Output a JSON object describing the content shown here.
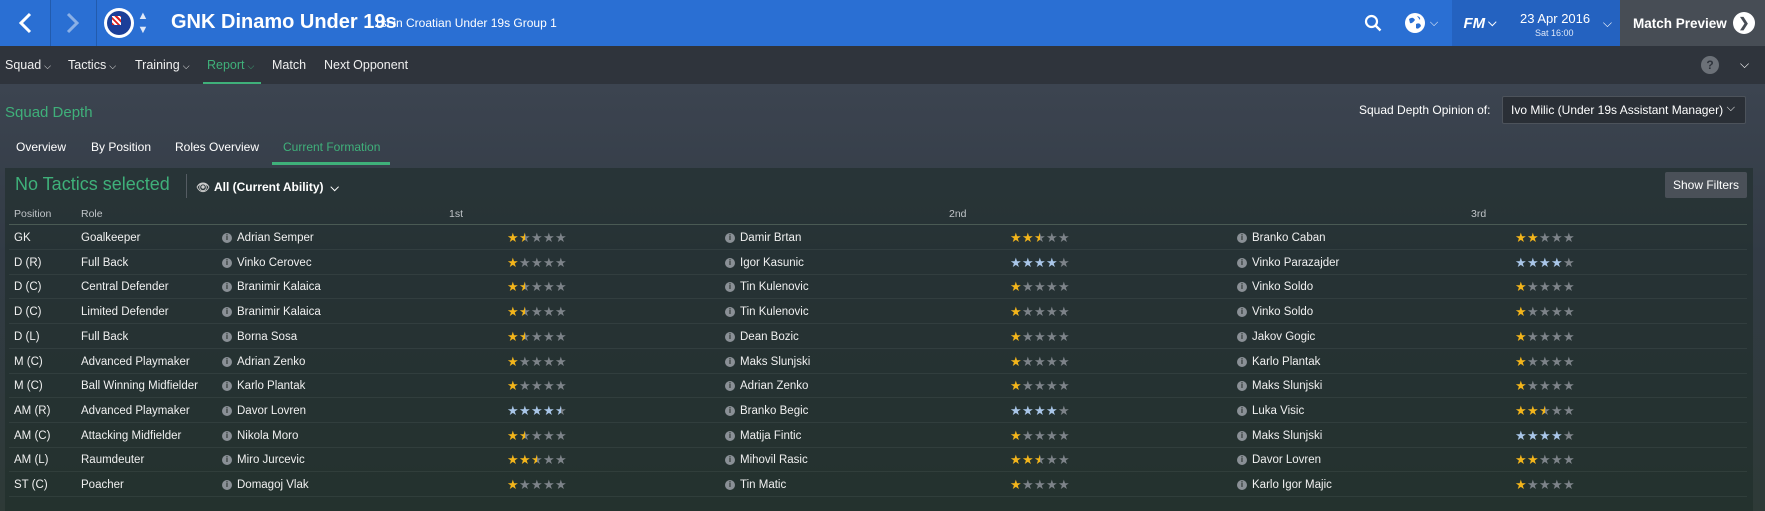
{
  "header": {
    "team_name": "GNK Dinamo Under 19s",
    "team_subtitle": "1st in Croatian Under 19s Group 1",
    "fm_label": "FM",
    "date": "23 Apr 2016",
    "time": "Sat 16:00",
    "continue_label": "Match Preview"
  },
  "menu": {
    "items": [
      {
        "label": "Squad"
      },
      {
        "label": "Tactics"
      },
      {
        "label": "Training"
      },
      {
        "label": "Report"
      },
      {
        "label": "Match"
      },
      {
        "label": "Next Opponent"
      }
    ],
    "help": "?"
  },
  "page": {
    "title": "Squad Depth",
    "opinion_label": "Squad Depth Opinion of:",
    "opinion_value": "Ivo Milic (Under 19s Assistant Manager)",
    "subtabs": [
      "Overview",
      "By Position",
      "Roles Overview",
      "Current Formation"
    ],
    "no_tactics": "No Tactics selected",
    "filter_label": "All (Current Ability)",
    "show_filters": "Show Filters"
  },
  "table": {
    "headers": {
      "position": "Position",
      "role": "Role",
      "first": "1st",
      "second": "2nd",
      "third": "3rd"
    },
    "rows": [
      {
        "pos": "GK",
        "role": "Goalkeeper",
        "p1": "Adrian Semper",
        "r1": 1.5,
        "p2": "Damir Brtan",
        "r2": 2.5,
        "p3": "Branko Caban",
        "r3": 2
      },
      {
        "pos": "D (R)",
        "role": "Full Back",
        "p1": "Vinko Cerovec",
        "r1": 1,
        "p2": "Igor Kasunic",
        "r2": 4,
        "p3": "Vinko Parazajder",
        "r3": 4
      },
      {
        "pos": "D (C)",
        "role": "Central Defender",
        "p1": "Branimir Kalaica",
        "r1": 1.5,
        "p2": "Tin Kulenovic",
        "r2": 1,
        "p3": "Vinko Soldo",
        "r3": 1
      },
      {
        "pos": "D (C)",
        "role": "Limited Defender",
        "p1": "Branimir Kalaica",
        "r1": 1.5,
        "p2": "Tin Kulenovic",
        "r2": 1,
        "p3": "Vinko Soldo",
        "r3": 1
      },
      {
        "pos": "D (L)",
        "role": "Full Back",
        "p1": "Borna Sosa",
        "r1": 1.5,
        "p2": "Dean Bozic",
        "r2": 1,
        "p3": "Jakov Gogic",
        "r3": 1
      },
      {
        "pos": "M (C)",
        "role": "Advanced Playmaker",
        "p1": "Adrian Zenko",
        "r1": 1,
        "p2": "Maks Slunjski",
        "r2": 1,
        "p3": "Karlo Plantak",
        "r3": 1
      },
      {
        "pos": "M (C)",
        "role": "Ball Winning Midfielder",
        "p1": "Karlo Plantak",
        "r1": 1,
        "p2": "Adrian Zenko",
        "r2": 1,
        "p3": "Maks Slunjski",
        "r3": 1
      },
      {
        "pos": "AM (R)",
        "role": "Advanced Playmaker",
        "p1": "Davor Lovren",
        "r1": 4.5,
        "p2": "Branko Begic",
        "r2": 4,
        "p3": "Luka Visic",
        "r3": 2.5
      },
      {
        "pos": "AM (C)",
        "role": "Attacking Midfielder",
        "p1": "Nikola Moro",
        "r1": 1.5,
        "p2": "Matija Fintic",
        "r2": 1,
        "p3": "Maks Slunjski",
        "r3": 4
      },
      {
        "pos": "AM (L)",
        "role": "Raumdeuter",
        "p1": "Miro Jurcevic",
        "r1": 2.5,
        "p2": "Mihovil Rasic",
        "r2": 2.5,
        "p3": "Davor Lovren",
        "r3": 2
      },
      {
        "pos": "ST (C)",
        "role": "Poacher",
        "p1": "Domagoj Vlak",
        "r1": 1,
        "p2": "Tin Matic",
        "r2": 1,
        "p3": "Karlo Igor Majic",
        "r3": 1
      }
    ]
  },
  "colors": {
    "accent": "#3fb07a",
    "topbar": "#2a6fd3",
    "star_gold": "#f3b51b",
    "star_blue": "#a9c6e8",
    "star_empty": "#7d8389"
  }
}
